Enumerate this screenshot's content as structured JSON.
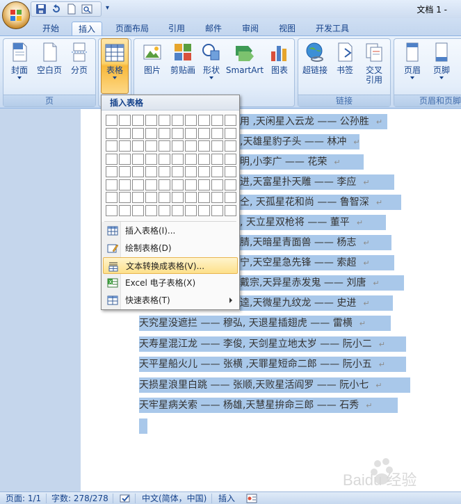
{
  "title_bar": {
    "doc_title": "文档 1 -"
  },
  "tabs": [
    {
      "label": "开始"
    },
    {
      "label": "插入",
      "active": true
    },
    {
      "label": "页面布局"
    },
    {
      "label": "引用"
    },
    {
      "label": "邮件"
    },
    {
      "label": "审阅"
    },
    {
      "label": "视图"
    },
    {
      "label": "开发工具"
    }
  ],
  "ribbon": {
    "group_pages": {
      "label": "页",
      "buttons": [
        "封面",
        "空白页",
        "分页"
      ]
    },
    "group_table": {
      "button": "表格"
    },
    "group_illustrations": {
      "buttons": [
        "图片",
        "剪贴画",
        "形状",
        "SmartArt",
        "图表"
      ]
    },
    "group_links": {
      "label": "链接",
      "buttons": [
        "超链接",
        "书签",
        "交叉",
        "引用"
      ]
    },
    "group_header_footer": {
      "label": "页眉和页脚",
      "buttons": [
        "页眉",
        "页脚"
      ]
    }
  },
  "dropdown": {
    "header": "插入表格",
    "items": [
      {
        "label": "插入表格(I)...",
        "icon": "table-icon"
      },
      {
        "label": "绘制表格(D)",
        "icon": "pencil-icon"
      },
      {
        "label": "文本转换成表格(V)...",
        "icon": "convert-icon",
        "highlighted": true
      },
      {
        "label": "Excel 电子表格(X)",
        "icon": "excel-icon"
      },
      {
        "label": "快速表格(T)",
        "icon": "quick-table-icon",
        "submenu": true
      }
    ]
  },
  "document": {
    "lines": [
      "用 ,天闲星入云龙 —— 公孙胜",
      ",天雄星豹子头 —— 林冲",
      "明,小李广 —— 花荣",
      "进,天富星扑天雕 —— 李应",
      "仝, 天孤星花和尚 —— 鲁智深",
      ", 天立星双枪将 —— 董平",
      "腈,天暗星青面兽 —— 杨志",
      "宁,天空星急先锋 —— 索超",
      "戴宗,天异星赤发鬼 —— 刘唐",
      "逵,天微星九纹龙 —— 史进",
      "天究星没遮拦 —— 穆弘, 天退星插翅虎 —— 雷横",
      "天寿星混江龙 —— 李俊, 天剑星立地太岁 —— 阮小二",
      "天平星船火儿 —— 张横 ,天罪星短命二郎 —— 阮小五",
      "天损星浪里白跳 —— 张顺,天败星活阎罗 —— 阮小七",
      "天牢星病关索 —— 杨雄,天慧星拚命三郎 —— 石秀"
    ],
    "paragraph_mark": "↵"
  },
  "status_bar": {
    "page": "页面: 1/1",
    "words": "字数: 278/278",
    "language": "中文(简体，中国)",
    "mode": "插入"
  },
  "watermark": {
    "text": "Baidu 经验"
  },
  "colors": {
    "selection": "#a9c8ea",
    "ribbon": "#dbe7f6",
    "highlight": "#fde08a"
  }
}
